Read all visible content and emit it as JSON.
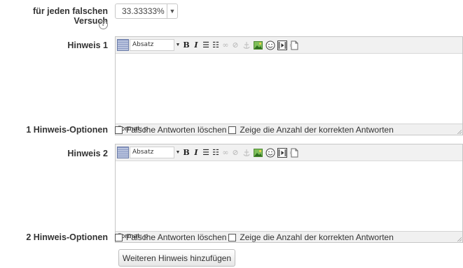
{
  "penalty": {
    "label": "für jeden falschen Versuch",
    "help_icon": "question-circle-icon",
    "value": "33.33333%"
  },
  "hints": [
    {
      "label": "Hinweis 1",
      "toolbar": {
        "format_label": "Absatz"
      },
      "status_path": "Format: p",
      "options_label": "1 Hinweis-Optionen",
      "option_clear": "Falsche Antworten löschen",
      "option_show": "Zeige die Anzahl der korrekten Antworten"
    },
    {
      "label": "Hinweis 2",
      "toolbar": {
        "format_label": "Absatz"
      },
      "status_path": "Format: p",
      "options_label": "2 Hinweis-Optionen",
      "option_clear": "Falsche Antworten löschen",
      "option_show": "Zeige die Anzahl der korrekten Antworten"
    }
  ],
  "toolbar_glyphs": {
    "bold": "B",
    "italic": "I",
    "bullets": "☰",
    "numbered": "☷",
    "link": "∞",
    "unlink": "⊘"
  },
  "add_hint_button": "Weiteren Hinweis hinzufügen"
}
